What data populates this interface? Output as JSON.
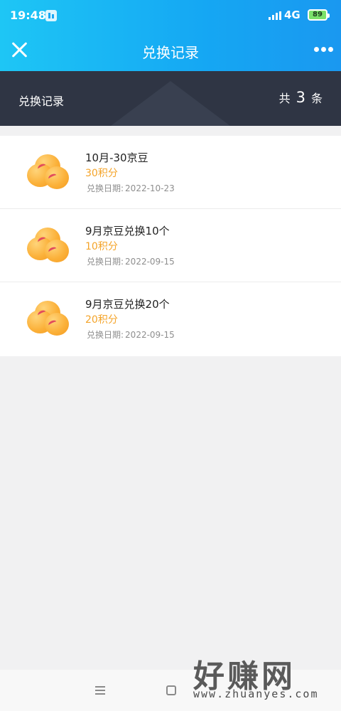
{
  "status_bar": {
    "time": "19:48",
    "network": "4G",
    "battery": "89"
  },
  "nav": {
    "title": "兑换记录"
  },
  "summary": {
    "title": "兑换记录",
    "prefix": "共",
    "count": "3",
    "suffix": "条"
  },
  "records": [
    {
      "title": "10月-30京豆",
      "points": "30积分",
      "date_label": "兑换日期:",
      "date": "2022-10-23"
    },
    {
      "title": "9月京豆兑换10个",
      "points": "10积分",
      "date_label": "兑换日期:",
      "date": "2022-09-15"
    },
    {
      "title": "9月京豆兑换20个",
      "points": "20积分",
      "date_label": "兑换日期:",
      "date": "2022-09-15"
    }
  ],
  "watermark": {
    "main": "好赚网",
    "url": "www.zhuanyes.com"
  },
  "colors": {
    "header_start": "#1ec6f5",
    "header_end": "#1a98f0",
    "summary_bg": "#2f3544",
    "points": "#f4a42a"
  }
}
